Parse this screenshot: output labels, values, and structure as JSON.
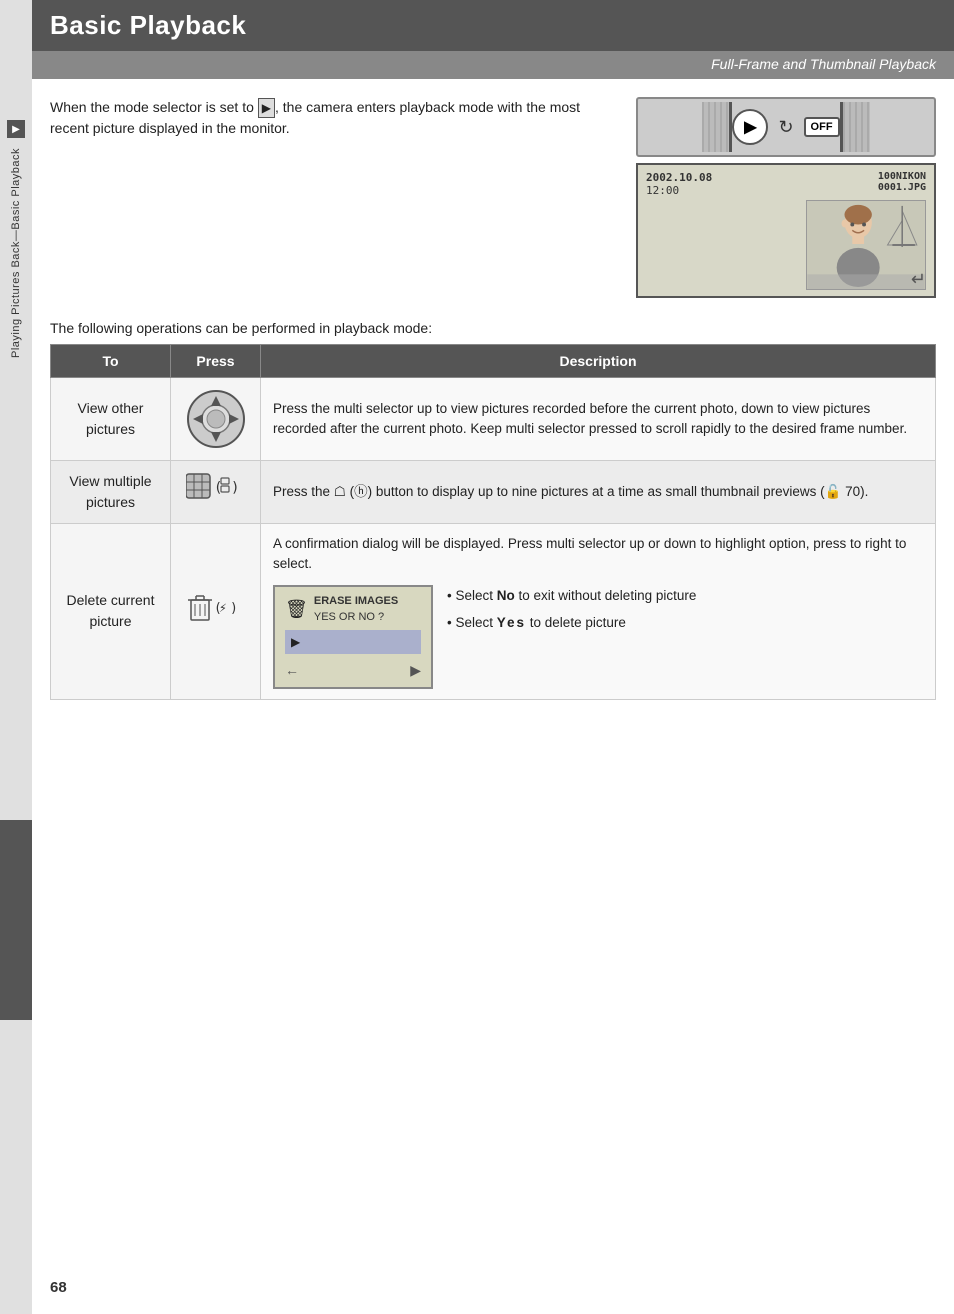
{
  "header": {
    "title": "Basic Playback",
    "subtitle": "Full-Frame and Thumbnail Playback"
  },
  "intro": {
    "text": "When the mode selector is set to ▶, the camera enters playback mode with the most recent picture displayed in the monitor.",
    "lcd": {
      "date": "2002.10.08",
      "time": "12:00",
      "fileinfo": "100NIKON",
      "filenum": "0001.JPG"
    }
  },
  "following_text": "The following operations can be performed in playback mode:",
  "table": {
    "headers": [
      "To",
      "Press",
      "Description"
    ],
    "rows": [
      {
        "to": "View other pictures",
        "press": "multi-selector",
        "description": "Press the multi selector up to view pictures recorded before the current photo, down to view pictures recorded after the current photo.  Keep multi selector pressed to scroll rapidly to the desired frame number."
      },
      {
        "to": "View multiple pictures",
        "press": "thumbnail-btn",
        "press_text": "❐ (ⓦ)",
        "description": "Press the ❐ (ⓦ) button to display up to nine pictures at a time as small thumbnail previews (☣ 70)."
      },
      {
        "to": "Delete current picture",
        "press": "delete-btn",
        "press_text": "ᴢ (⚡)",
        "description_intro": "A confirmation dialog will be displayed.  Press multi selector up or down to highlight option, press to right to select.",
        "erase_dialog": {
          "title": "ERASE IMAGES",
          "subtitle": "YES OR NO ?",
          "highlight": "▷"
        },
        "bullets": [
          "Select No to exit without deleting picture",
          "Select Yes to delete picture"
        ]
      }
    ]
  },
  "page_number": "68",
  "side_tab": {
    "label": "Playing Pictures Back—Basic Playback"
  }
}
